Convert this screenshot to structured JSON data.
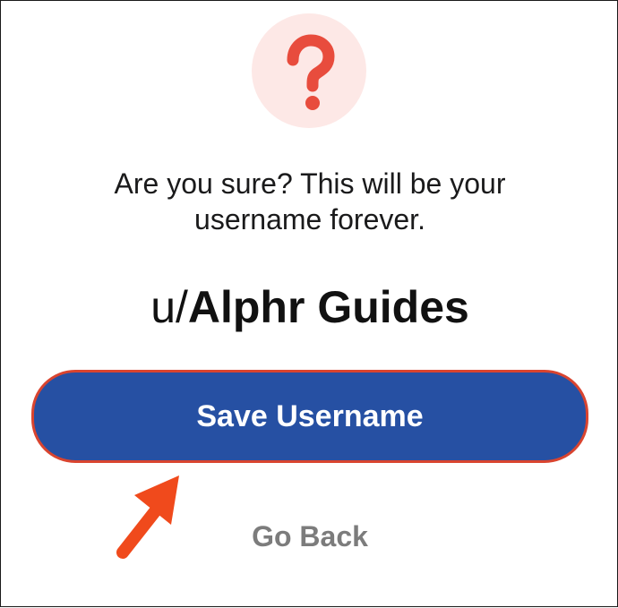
{
  "dialog": {
    "icon": "question-mark-icon",
    "message": "Are you sure? This will be your username forever.",
    "username_prefix": "u/",
    "username_name": "Alphr Guides",
    "save_label": "Save Username",
    "go_back_label": "Go Back"
  },
  "colors": {
    "primary_button": "#2650a3",
    "button_outline": "#d9442f",
    "icon_bg": "#fde8e6",
    "icon_fg": "#e84c3d",
    "arrow": "#f04a1c",
    "secondary_text": "#7c7c7c"
  }
}
